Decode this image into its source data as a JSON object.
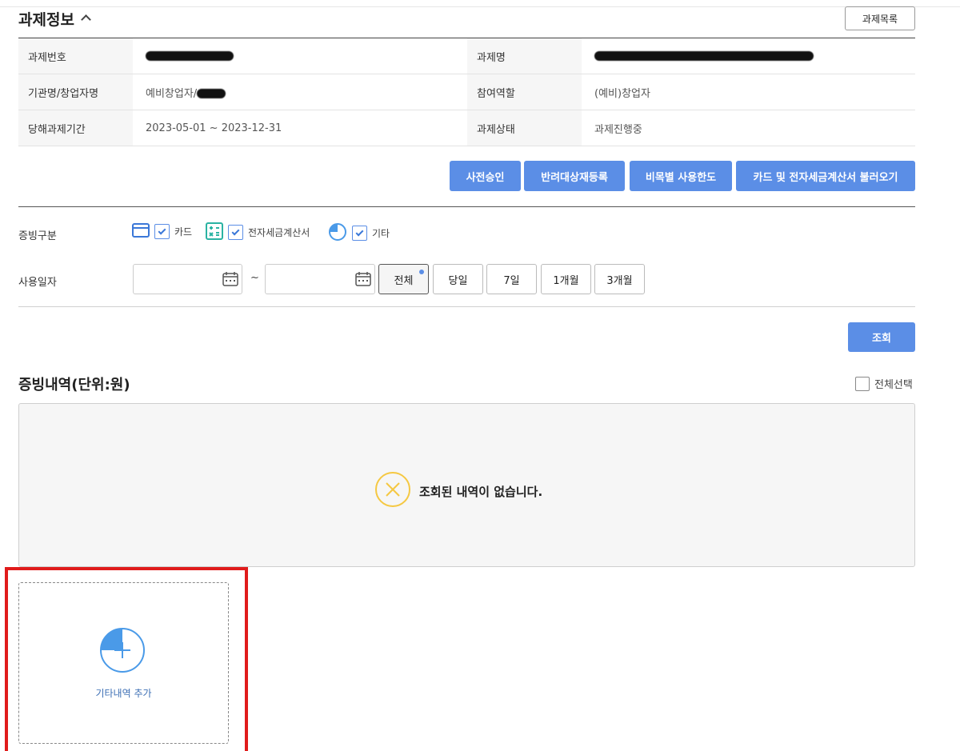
{
  "section": {
    "title": "과제정보",
    "list_button": "과제목록"
  },
  "info": {
    "rows": [
      {
        "l1": "과제번호",
        "v1": "",
        "l2": "과제명",
        "v2": ""
      },
      {
        "l1": "기관명/창업자명",
        "v1": "예비창업자/",
        "l2": "참여역할",
        "v2": "(예비)창업자"
      },
      {
        "l1": "당해과제기간",
        "v1": "2023-05-01 ~ 2023-12-31",
        "l2": "과제상태",
        "v2": "과제진행중"
      }
    ]
  },
  "actions": [
    "사전승인",
    "반려대상재등록",
    "비목별 사용한도",
    "카드 및 전자세금계산서 불러오기"
  ],
  "filters": {
    "evidence_label": "증빙구분",
    "types": [
      {
        "label": "카드",
        "checked": true,
        "icon": "card-icon"
      },
      {
        "label": "전자세금계산서",
        "checked": true,
        "icon": "calculator-icon"
      },
      {
        "label": "기타",
        "checked": true,
        "icon": "pie-icon"
      }
    ],
    "date_label": "사용일자",
    "date_from": "",
    "date_to": "",
    "tilde": "~",
    "periods": [
      "전체",
      "당일",
      "7일",
      "1개월",
      "3개월"
    ],
    "active_period": "전체"
  },
  "search_button": "조회",
  "list": {
    "title": "증빙내역(단위:원)",
    "select_all": "전체선택",
    "empty_message": "조회된 내역이 없습니다."
  },
  "add_card": {
    "label": "기타내역 추가"
  },
  "colors": {
    "primary": "#5b8ee6",
    "highlight": "#e01b1b",
    "warning": "#f5c842"
  }
}
